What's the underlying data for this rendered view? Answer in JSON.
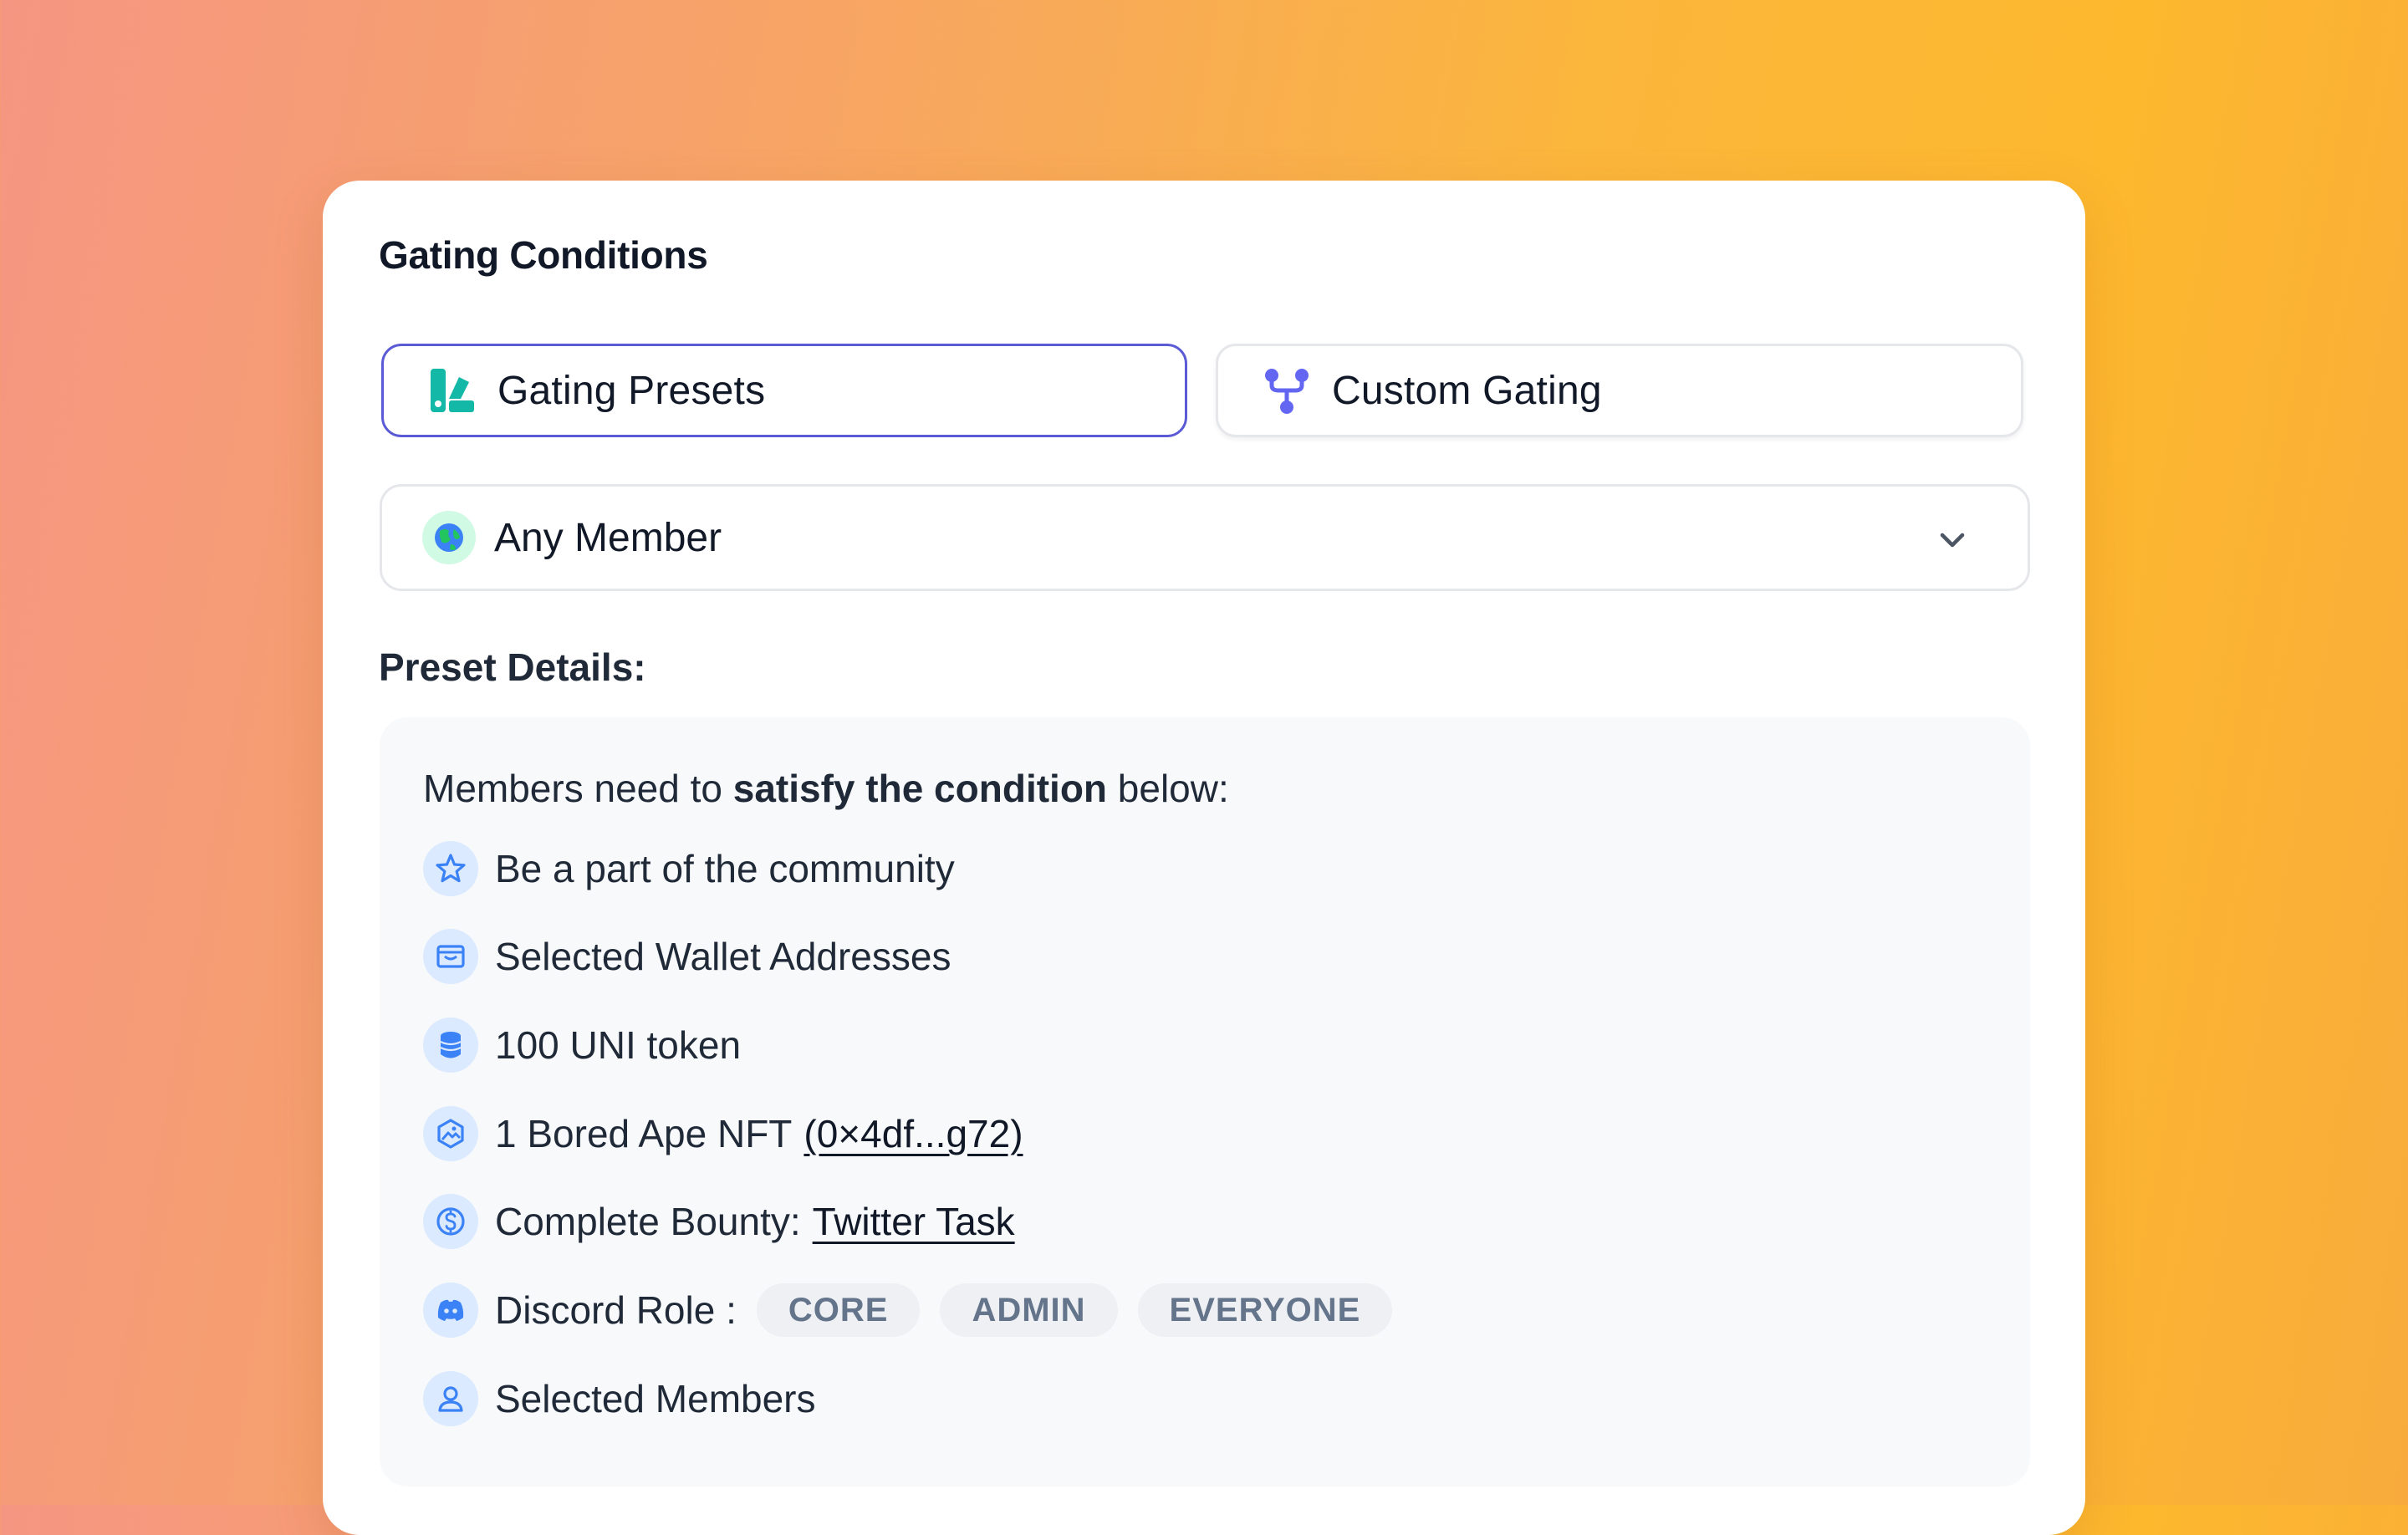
{
  "card": {
    "title": "Gating Conditions"
  },
  "tabs": [
    {
      "label": "Gating Presets",
      "icon": "presets-icon",
      "active": true
    },
    {
      "label": "Custom Gating",
      "icon": "branch-icon",
      "active": false
    }
  ],
  "preset_select": {
    "value": "Any Member",
    "icon": "globe-icon"
  },
  "preset_details": {
    "heading": "Preset Details:",
    "intro_prefix": "Members need to",
    "intro_bold": "satisfy the condition",
    "intro_suffix": "below:",
    "conditions": [
      {
        "icon": "star-icon",
        "text": "Be a part of the community"
      },
      {
        "icon": "wallet-icon",
        "text": "Selected Wallet Addresses"
      },
      {
        "icon": "coins-icon",
        "text": "100 UNI token"
      },
      {
        "icon": "nft-icon",
        "text": "1 Bored Ape NFT",
        "link": "(0×4df...g72)"
      },
      {
        "icon": "dollar-icon",
        "text": "Complete Bounty:",
        "link": "Twitter Task"
      },
      {
        "icon": "discord-icon",
        "text": "Discord Role :",
        "chips": [
          "CORE",
          "ADMIN",
          "EVERYONE"
        ]
      },
      {
        "icon": "users-icon",
        "text": "Selected Members"
      }
    ]
  },
  "colors": {
    "accent": "#5b5bd6",
    "preset_icon": "#14b8a6",
    "condition_icon": "#3b82f6",
    "chip_text": "#64748b"
  }
}
